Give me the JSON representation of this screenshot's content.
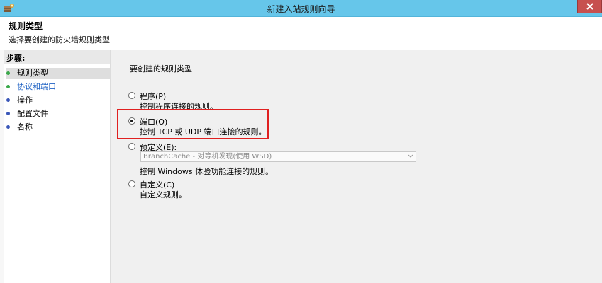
{
  "window": {
    "title": "新建入站规则向导"
  },
  "header": {
    "title": "规则类型",
    "subtitle": "选择要创建的防火墙规则类型"
  },
  "steps": {
    "title": "步骤:",
    "items": [
      {
        "label": "规则类型",
        "dot_color": "#3aa84a"
      },
      {
        "label": "协议和端口",
        "dot_color": "#3aa84a"
      },
      {
        "label": "操作",
        "dot_color": "#3a56b8"
      },
      {
        "label": "配置文件",
        "dot_color": "#3a56b8"
      },
      {
        "label": "名称",
        "dot_color": "#3a56b8"
      }
    ]
  },
  "main": {
    "prompt": "要创建的规则类型",
    "options": [
      {
        "label": "程序(P)",
        "desc": "控制程序连接的规则。",
        "checked": false
      },
      {
        "label": "端口(O)",
        "desc": "控制 TCP 或 UDP 端口连接的规则。",
        "checked": true
      },
      {
        "label": "预定义(E):",
        "desc": "控制 Windows 体验功能连接的规则。",
        "checked": false
      },
      {
        "label": "自定义(C)",
        "desc": "自定义规则。",
        "checked": false
      }
    ],
    "predefined_select": {
      "value": "BranchCache - 对等机发现(使用 WSD)"
    }
  },
  "colors": {
    "titlebar": "#66c6ea",
    "close": "#c7504f",
    "highlight": "#e02020",
    "link": "#1f62c4"
  }
}
